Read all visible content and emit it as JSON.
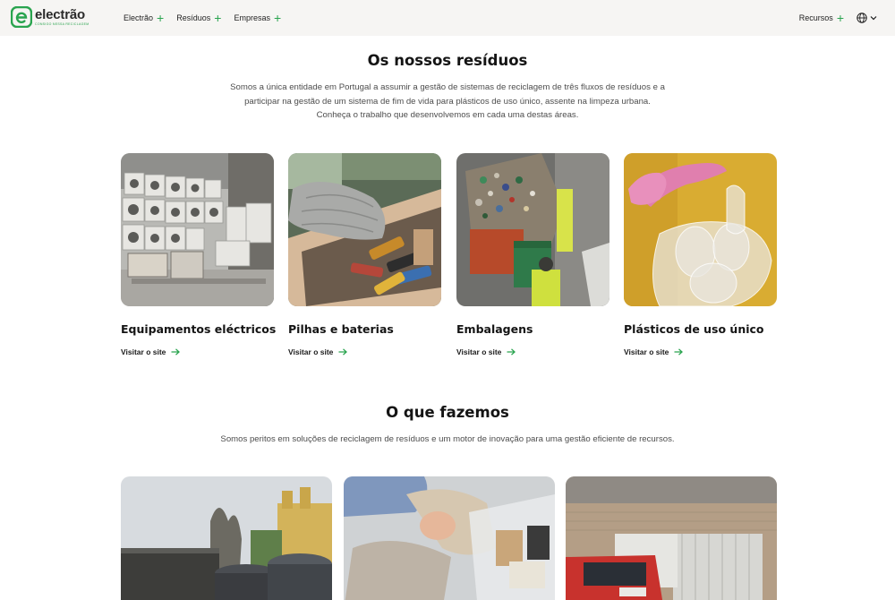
{
  "header": {
    "logo_name": "electrão",
    "logo_tagline": "CONSIGO NESSA RECICLAGEM",
    "nav": [
      {
        "label": "Electrão"
      },
      {
        "label": "Resíduos"
      },
      {
        "label": "Empresas"
      }
    ],
    "resources_label": "Recursos",
    "plus_glyph": "+"
  },
  "residues": {
    "title": "Os nossos resíduos",
    "intro_lines": [
      "Somos a única entidade em Portugal a assumir a gestão de sistemas de reciclagem de três fluxos de resíduos e a",
      "participar na gestão de um sistema de fim de vida para plásticos de uso único, assente na limpeza urbana.",
      "Conheça o trabalho que desenvolvemos em cada uma destas áreas."
    ],
    "cards": [
      {
        "title": "Equipamentos eléctricos",
        "link": "Visitar o site"
      },
      {
        "title": "Pilhas e baterias",
        "link": "Visitar o site"
      },
      {
        "title": "Embalagens",
        "link": "Visitar o site"
      },
      {
        "title": "Plásticos de uso único",
        "link": "Visitar o site"
      }
    ]
  },
  "what_we_do": {
    "title": "O que fazemos",
    "subtitle": "Somos peritos em soluções de reciclagem de resíduos e um motor de inovação para uma gestão eficiente de recursos."
  },
  "colors": {
    "accent": "#2aa44f",
    "header_bg": "#f6f5f3",
    "text": "#141414"
  }
}
